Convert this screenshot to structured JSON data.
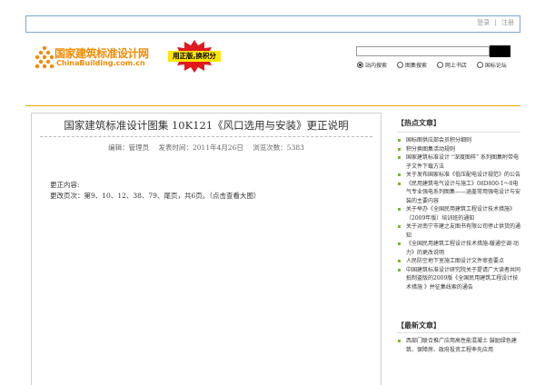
{
  "header": {
    "login_label": "登录",
    "separator": "|",
    "register_label": "注册"
  },
  "logo": {
    "name_cn": "国家建筑标准设计网",
    "domain": "ChinaBuilding.com.cn"
  },
  "promo_badge": {
    "text": "用正版,换积分"
  },
  "search": {
    "input_value": "",
    "button_label": "",
    "options": [
      "站内搜索",
      "图集搜索",
      "网上书店",
      "国标论坛"
    ],
    "selected": "站内搜索"
  },
  "article": {
    "title": "国家建筑标准设计图集 10K121《风口选用与安装》更正说明",
    "meta": {
      "editor": "编辑：管理员",
      "published": "发表时间：2011年4月26日",
      "views": "浏览次数：5383"
    },
    "content_label": "更正内容:",
    "content_text": "更改页次：第9、10、12、38、79、尾页，共6页。（点击查看大图）"
  },
  "sidebar": {
    "hot_title": "【热点文章】",
    "hot_items": [
      "国标图供应部会员积分细则",
      "积分换图集活动规则",
      "国家建筑标准设计 “深度图样” 系列图集附带电子文件下载方法",
      "关于发布国家标准《低压配电设计规范》的公告",
      "《民用建筑电气设计与施工》08D800-1～8电气专业强电系列图集——涵盖常用强电设计与安装的主要内容",
      "关于举办《全国民用建筑工程设计技术措施》（2009年版）培训班的通知",
      "关于对南宁市建之友图书有限公司停止供货的通知",
      "《全国民用建筑工程设计技术措施-暖通空调·动力》的更改说明",
      "人民防空地下室施工图设计文件审查要点",
      "中国建筑标准设计研究院关于提请广大读者共同抵制盗版的2009版《全国民用建筑工程设计技术措施 》并征集线索的通告"
    ],
    "new_title": "【最新文章】",
    "new_items": [
      "西部门联合推广应用高性能混凝土 鼓励绿色建筑、保障房、政府投资工程率先应用"
    ]
  },
  "colors": {
    "top_border": "#7aa7d8",
    "accent_orange": "#f0a300",
    "logo_orange": "#f28a00",
    "badge_red": "#e0191f",
    "badge_yellow": "#ffe600",
    "bullet_green": "#7bb23a"
  }
}
